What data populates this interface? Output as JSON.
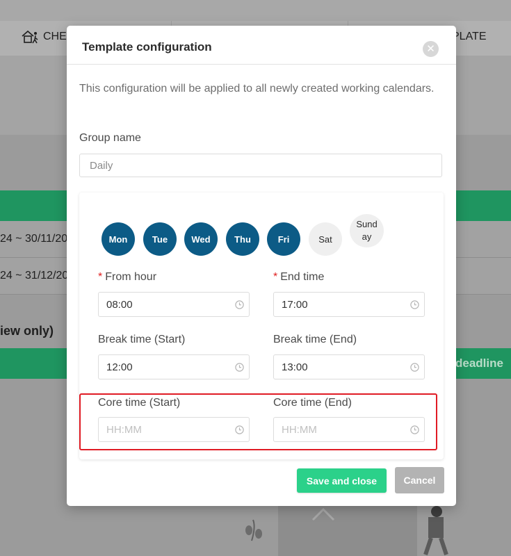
{
  "background": {
    "nav_check_label": "CHE",
    "nav_template_label": "PLATE",
    "row1_text": "24 ~ 30/11/20",
    "row2_text": "24 ~ 31/12/20",
    "view_only_text": "iew only)",
    "deadline_text": "deadline"
  },
  "modal": {
    "title": "Template configuration",
    "close_glyph": "✕",
    "description": "This configuration will be applied to all newly created working calendars.",
    "group_name_label": "Group name",
    "group_name_value": "Daily",
    "days": [
      {
        "label": "Mon",
        "selected": true
      },
      {
        "label": "Tue",
        "selected": true
      },
      {
        "label": "Wed",
        "selected": true
      },
      {
        "label": "Thu",
        "selected": true
      },
      {
        "label": "Fri",
        "selected": true
      },
      {
        "label": "Sat",
        "selected": false
      },
      {
        "label": "Sund ay",
        "selected": false
      }
    ],
    "from_hour": {
      "label": "From hour",
      "required": "*",
      "value": "08:00"
    },
    "end_time": {
      "label": "End time",
      "required": "*",
      "value": "17:00"
    },
    "break_start": {
      "label": "Break time (Start)",
      "value": "12:00"
    },
    "break_end": {
      "label": "Break time (End)",
      "value": "13:00"
    },
    "core_start": {
      "label": "Core time (Start)",
      "placeholder": "HH:MM"
    },
    "core_end": {
      "label": "Core time (End)",
      "placeholder": "HH:MM"
    },
    "save_label": "Save and close",
    "cancel_label": "Cancel"
  },
  "colors": {
    "day_selected": "#0c5b86",
    "save_button": "#2bd18a",
    "highlight_border": "#e01b24",
    "background_green": "#1f9560"
  },
  "icons": {
    "nav": "checkin-house-icon",
    "close": "close-icon",
    "time_field": "clock-icon"
  }
}
